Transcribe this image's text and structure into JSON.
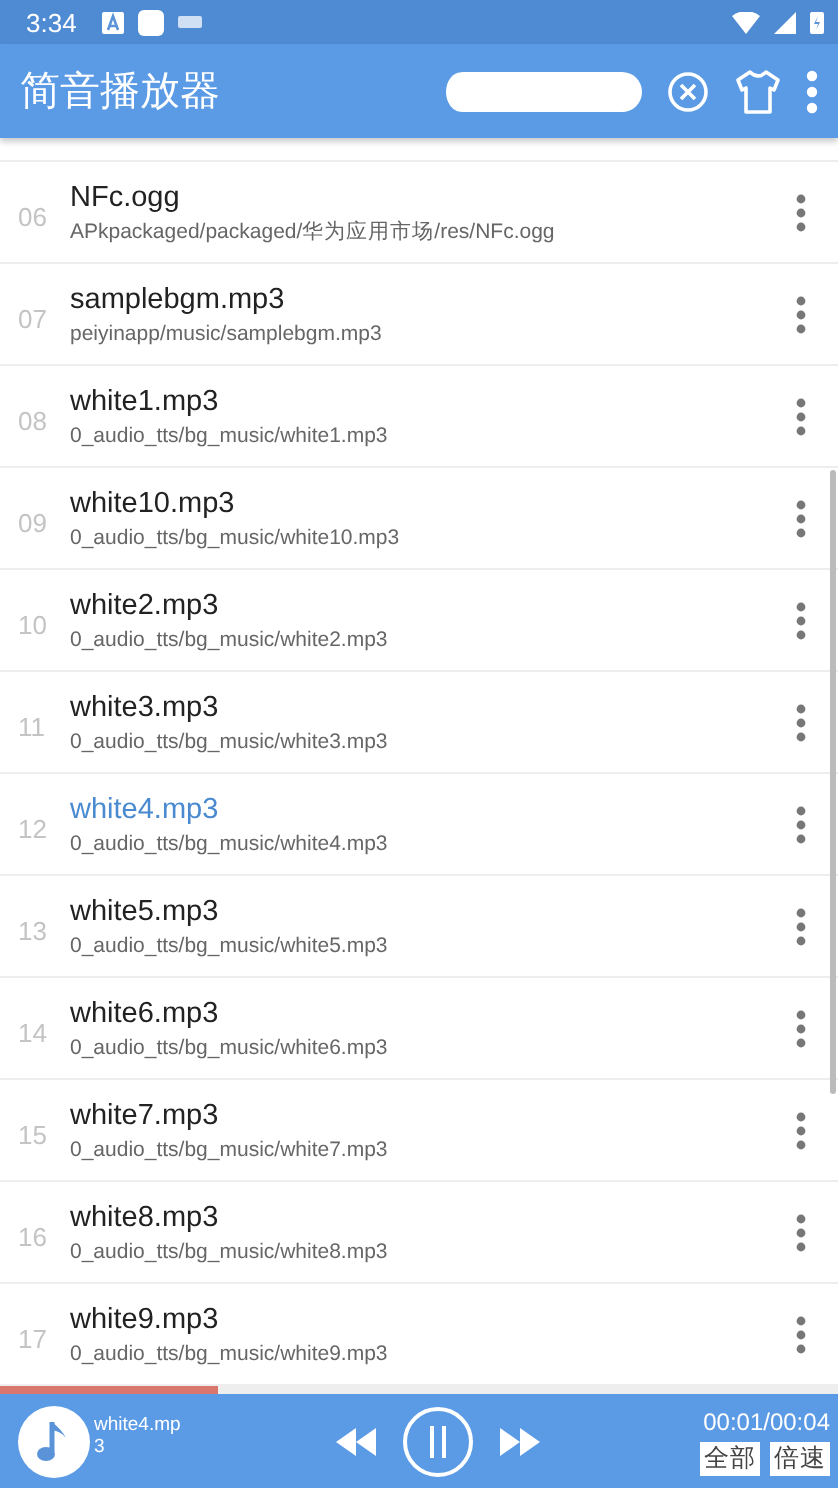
{
  "status_bar": {
    "time": "3:34"
  },
  "app_bar": {
    "title": "简音播放器"
  },
  "tracks": [
    {
      "number": "06",
      "title": "NFc.ogg",
      "path": "APkpackaged/packaged/华为应用市场/res/NFc.ogg",
      "selected": false
    },
    {
      "number": "07",
      "title": "samplebgm.mp3",
      "path": "peiyinapp/music/samplebgm.mp3",
      "selected": false
    },
    {
      "number": "08",
      "title": "white1.mp3",
      "path": "0_audio_tts/bg_music/white1.mp3",
      "selected": false
    },
    {
      "number": "09",
      "title": "white10.mp3",
      "path": "0_audio_tts/bg_music/white10.mp3",
      "selected": false
    },
    {
      "number": "10",
      "title": "white2.mp3",
      "path": "0_audio_tts/bg_music/white2.mp3",
      "selected": false
    },
    {
      "number": "11",
      "title": "white3.mp3",
      "path": "0_audio_tts/bg_music/white3.mp3",
      "selected": false
    },
    {
      "number": "12",
      "title": "white4.mp3",
      "path": "0_audio_tts/bg_music/white4.mp3",
      "selected": true
    },
    {
      "number": "13",
      "title": "white5.mp3",
      "path": "0_audio_tts/bg_music/white5.mp3",
      "selected": false
    },
    {
      "number": "14",
      "title": "white6.mp3",
      "path": "0_audio_tts/bg_music/white6.mp3",
      "selected": false
    },
    {
      "number": "15",
      "title": "white7.mp3",
      "path": "0_audio_tts/bg_music/white7.mp3",
      "selected": false
    },
    {
      "number": "16",
      "title": "white8.mp3",
      "path": "0_audio_tts/bg_music/white8.mp3",
      "selected": false
    },
    {
      "number": "17",
      "title": "white9.mp3",
      "path": "0_audio_tts/bg_music/white9.mp3",
      "selected": false
    }
  ],
  "player": {
    "level": 0.26,
    "now_playing": "white4.mp3",
    "time": "00:01/00:04",
    "playing": true,
    "buttons": [
      "全部",
      "倍速"
    ]
  }
}
